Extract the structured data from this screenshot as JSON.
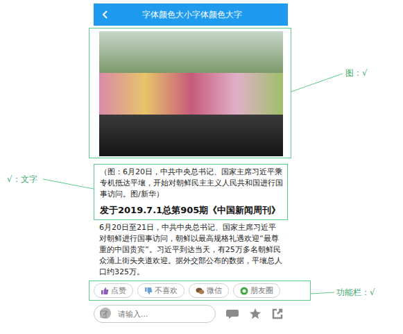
{
  "header": {
    "title": "字体颜色大小字体颜色大字"
  },
  "annotations": [
    {
      "label": "图：√"
    },
    {
      "label": "√：文字"
    },
    {
      "label": "功能栏：√"
    }
  ],
  "caption": "（图：6月20日，中共中央总书记、国家主席习近平乘专机抵达平壤，开始对朝鲜民主主义人民共和国进行国事访问。图/新华）",
  "source": "发于2019.7.1总第905期《中国新闻周刊》",
  "body": "6月20日至21日，中共中央总书记、国家主席习近平对朝鲜进行国事访问，朝鲜以最高规格礼遇欢迎“最尊重的中国贵宾”。习近平到达当天，有25万多名朝鲜民众涌上街头夹道欢迎。据外交部公布的数据，平壤总人口约325万。",
  "actions": [
    {
      "label": "点赞",
      "kind": "like"
    },
    {
      "label": "不喜欢",
      "kind": "dislike"
    },
    {
      "label": "微信",
      "kind": "wechat"
    },
    {
      "label": "朋友圈",
      "kind": "moments"
    }
  ],
  "comment_input": {
    "placeholder": "请输入..."
  }
}
